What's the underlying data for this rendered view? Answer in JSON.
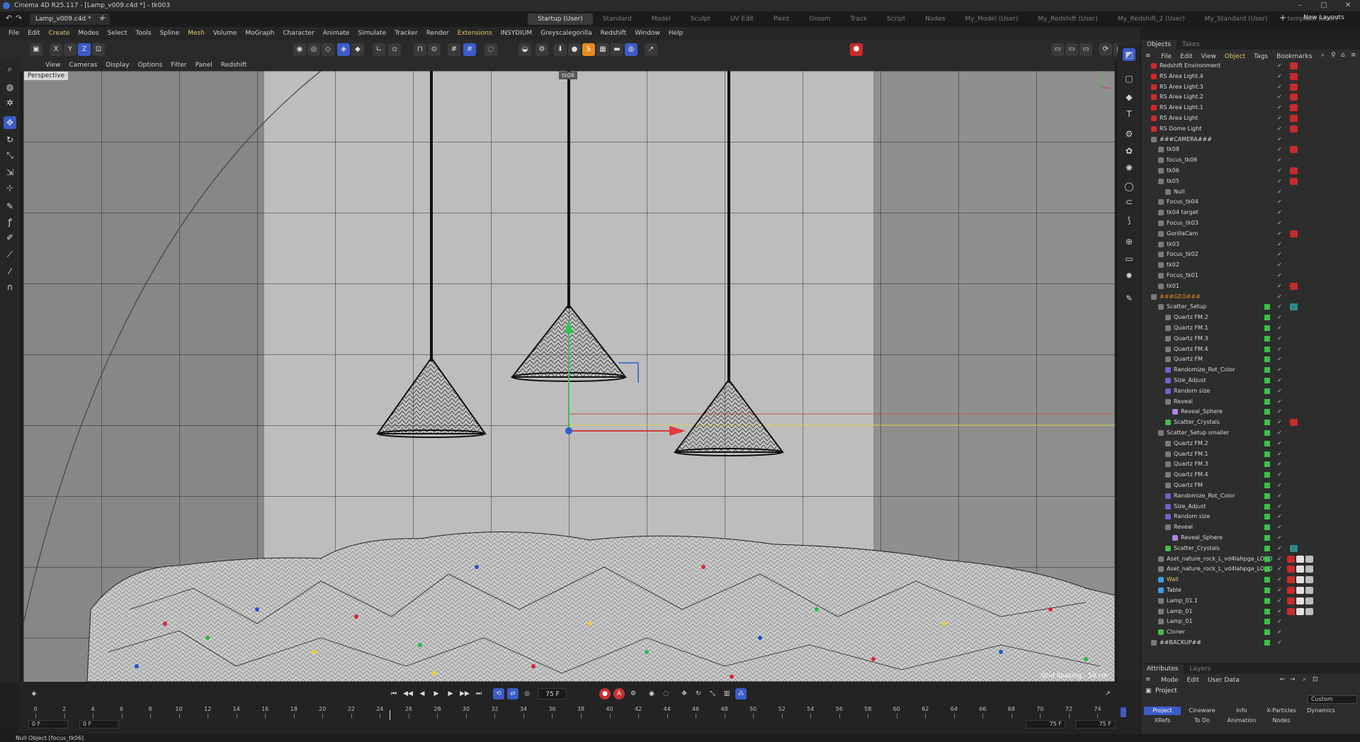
{
  "window": {
    "title": "Cinema 4D R25.117 - [Lamp_v009.c4d *] - tk003",
    "controls": [
      "–",
      "□",
      "✕"
    ]
  },
  "doc_tab": {
    "label": "Lamp_v009.c4d *"
  },
  "layouts": {
    "items": [
      "Startup (User)",
      "Standard",
      "Model",
      "Sculpt",
      "UV Edit",
      "Paint",
      "Groom",
      "Track",
      "Script",
      "Nodes",
      "My_Model (User)",
      "My_Redshift (User)",
      "My_Redshift_2 (User)",
      "My_Standard (User)",
      "template (User)"
    ],
    "new_layouts": "New Layouts"
  },
  "menu": [
    "File",
    "Edit",
    "Create",
    "Modes",
    "Select",
    "Tools",
    "Spline",
    "Mesh",
    "Volume",
    "MoGraph",
    "Character",
    "Animate",
    "Simulate",
    "Tracker",
    "Render",
    "Extensions",
    "INSYDIUM",
    "Greyscalegorilla",
    "Redshift",
    "Window",
    "Help"
  ],
  "toolbar": {
    "axes": [
      "X",
      "Y",
      "Z"
    ]
  },
  "viewport": {
    "menu": [
      "View",
      "Cameras",
      "Display",
      "Options",
      "Filter",
      "Panel",
      "Redshift"
    ],
    "label": "Perspective",
    "camera_tag": "tk08",
    "grid_spacing": "Grid Spacing : 50 cm"
  },
  "timeline": {
    "current_frame": "75 F",
    "ticks": [
      "0",
      "2",
      "4",
      "6",
      "8",
      "10",
      "12",
      "14",
      "16",
      "18",
      "20",
      "22",
      "24",
      "26",
      "28",
      "30",
      "32",
      "34",
      "36",
      "38",
      "40",
      "42",
      "44",
      "46",
      "48",
      "50",
      "52",
      "54",
      "56",
      "58",
      "60",
      "62",
      "64",
      "66",
      "68",
      "70",
      "72",
      "74"
    ],
    "start_field": "0 F",
    "start_field2": "0 F",
    "end_field": "75 F",
    "end_field2": "75 F"
  },
  "status": {
    "text": "Null Object [focus_tk06]"
  },
  "object_panel": {
    "tabs": [
      "Objects",
      "Takes"
    ],
    "menu": [
      "File",
      "Edit",
      "View",
      "Object",
      "Tags",
      "Bookmarks"
    ],
    "rows": [
      {
        "label": "Redshift Environment",
        "indent": 0,
        "type": "rs"
      },
      {
        "label": "RS Area Light.4",
        "indent": 0,
        "type": "rs"
      },
      {
        "label": "RS Area Light.3",
        "indent": 0,
        "type": "rs"
      },
      {
        "label": "RS Area Light.2",
        "indent": 0,
        "type": "rs"
      },
      {
        "label": "RS Area Light.1",
        "indent": 0,
        "type": "rs"
      },
      {
        "label": "RS Area Light",
        "indent": 0,
        "type": "rs"
      },
      {
        "label": "RS Dome Light",
        "indent": 0,
        "type": "rs"
      },
      {
        "label": "###CAMERA###",
        "indent": 0,
        "type": "null"
      },
      {
        "label": "tk08",
        "indent": 1,
        "type": "cam"
      },
      {
        "label": "focus_tk06",
        "indent": 1,
        "type": "null"
      },
      {
        "label": "tk06",
        "indent": 1,
        "type": "cam"
      },
      {
        "label": "tk05",
        "indent": 1,
        "type": "cam"
      },
      {
        "label": "Null",
        "indent": 2,
        "type": "null"
      },
      {
        "label": "Focus_tk04",
        "indent": 1,
        "type": "null"
      },
      {
        "label": "tk04 target",
        "indent": 1,
        "type": "null"
      },
      {
        "label": "Focus_tk03",
        "indent": 1,
        "type": "null"
      },
      {
        "label": "GorillaCam",
        "indent": 1,
        "type": "cam"
      },
      {
        "label": "tk03",
        "indent": 1,
        "type": "null"
      },
      {
        "label": "Focus_tk02",
        "indent": 1,
        "type": "null"
      },
      {
        "label": "tk02",
        "indent": 1,
        "type": "null"
      },
      {
        "label": "Focus_tk01",
        "indent": 1,
        "type": "null"
      },
      {
        "label": "tk01",
        "indent": 1,
        "type": "null"
      },
      {
        "label": "###GEO###",
        "indent": 0,
        "type": "geo"
      },
      {
        "label": "Scatter_Setup",
        "indent": 1,
        "type": "null"
      },
      {
        "label": "Quartz FM.2",
        "indent": 2,
        "type": "null"
      },
      {
        "label": "Quartz FM.1",
        "indent": 2,
        "type": "null"
      },
      {
        "label": "Quartz FM.3",
        "indent": 2,
        "type": "null"
      },
      {
        "label": "Quartz FM.4",
        "indent": 2,
        "type": "null"
      },
      {
        "label": "Quartz FM",
        "indent": 2,
        "type": "null"
      },
      {
        "label": "Randomize_Rot_Color",
        "indent": 2,
        "type": "fx"
      },
      {
        "label": "Size_Adjust",
        "indent": 2,
        "type": "fx"
      },
      {
        "label": "Random size",
        "indent": 2,
        "type": "fx"
      },
      {
        "label": "Reveal",
        "indent": 2,
        "type": "null"
      },
      {
        "label": "Reveal_Sphere",
        "indent": 3,
        "type": "sph"
      },
      {
        "label": "Scatter_Crystals",
        "indent": 2,
        "type": "cl"
      },
      {
        "label": "Scatter_Setup smaller",
        "indent": 1,
        "type": "null"
      },
      {
        "label": "Quartz FM.2",
        "indent": 2,
        "type": "null"
      },
      {
        "label": "Quartz FM.1",
        "indent": 2,
        "type": "null"
      },
      {
        "label": "Quartz FM.3",
        "indent": 2,
        "type": "null"
      },
      {
        "label": "Quartz FM.4",
        "indent": 2,
        "type": "null"
      },
      {
        "label": "Quartz FM",
        "indent": 2,
        "type": "null"
      },
      {
        "label": "Randomize_Rot_Color",
        "indent": 2,
        "type": "fx"
      },
      {
        "label": "Size_Adjust",
        "indent": 2,
        "type": "fx"
      },
      {
        "label": "Random size",
        "indent": 2,
        "type": "fx"
      },
      {
        "label": "Reveal",
        "indent": 2,
        "type": "null"
      },
      {
        "label": "Reveal_Sphere",
        "indent": 3,
        "type": "sph"
      },
      {
        "label": "Scatter_Crystals",
        "indent": 2,
        "type": "cl"
      },
      {
        "label": "Aset_nature_rock_L_vd4lahpga_LOD0",
        "indent": 1,
        "type": "null"
      },
      {
        "label": "Aset_nature_rock_L_vd4lahpga_LOD0",
        "indent": 1,
        "type": "null"
      },
      {
        "label": "Wall",
        "indent": 1,
        "type": "poly",
        "highlight": true
      },
      {
        "label": "Table",
        "indent": 1,
        "type": "poly"
      },
      {
        "label": "Lamp_01.1",
        "indent": 1,
        "type": "null"
      },
      {
        "label": "Lamp_01",
        "indent": 1,
        "type": "null"
      },
      {
        "label": "Lamp_01",
        "indent": 1,
        "type": "null"
      },
      {
        "label": "Cloner",
        "indent": 1,
        "type": "cl"
      },
      {
        "label": "##BACKUP##",
        "indent": 0,
        "type": "null"
      }
    ]
  },
  "attributes": {
    "tabs": [
      "Attributes",
      "Layers"
    ],
    "menu": [
      "Mode",
      "Edit",
      "User Data"
    ],
    "title": "Project",
    "dropdown": "Custom",
    "subtabs": [
      "Project",
      "Cineware",
      "Info",
      "X-Particles",
      "Dynamics",
      "XRefs",
      "To Do",
      "Animation",
      "Nodes"
    ]
  },
  "colors": {
    "accent": "#3b5cc8",
    "highlight_text": "#e7c46b",
    "rs_red": "#d02a2a",
    "visible_green": "#3ac04a"
  }
}
